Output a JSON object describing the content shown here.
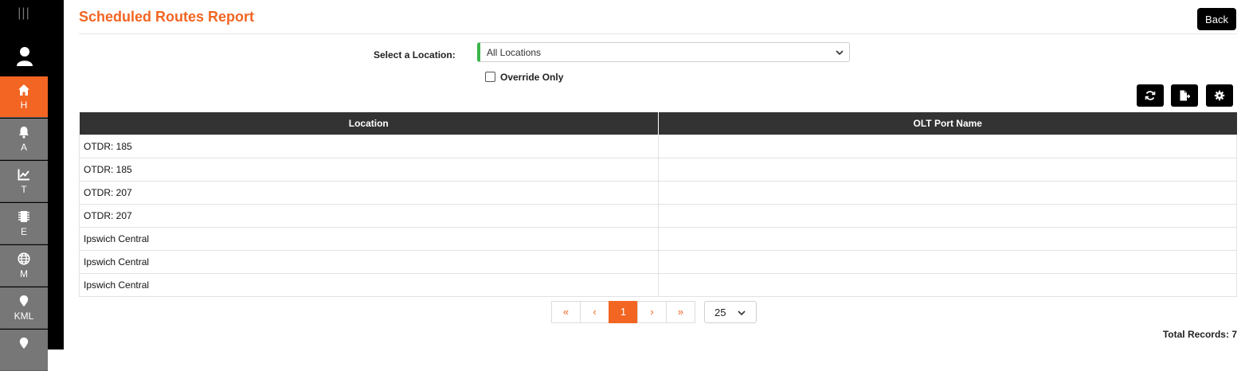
{
  "sidebar": {
    "menu_glyph": "|||",
    "items": [
      {
        "label": "H",
        "icon": "home-icon",
        "active": true
      },
      {
        "label": "A",
        "icon": "bell-icon",
        "active": false
      },
      {
        "label": "T",
        "icon": "trend-chart-icon",
        "active": false
      },
      {
        "label": "E",
        "icon": "chip-icon",
        "active": false
      },
      {
        "label": "M",
        "icon": "globe-icon",
        "active": false
      },
      {
        "label": "KML",
        "icon": "map-pin-icon",
        "active": false
      }
    ]
  },
  "header": {
    "title": "Scheduled Routes Report",
    "back_label": "Back"
  },
  "filters": {
    "location_label": "Select a Location:",
    "location_value": "All Locations",
    "override_label": "Override Only",
    "override_checked": false
  },
  "table": {
    "columns": [
      "Location",
      "OLT Port Name"
    ],
    "rows": [
      [
        "OTDR: 185",
        ""
      ],
      [
        "OTDR: 185",
        ""
      ],
      [
        "OTDR: 207",
        ""
      ],
      [
        "OTDR: 207",
        ""
      ],
      [
        "Ipswich Central",
        ""
      ],
      [
        "Ipswich Central",
        ""
      ],
      [
        "Ipswich Central",
        ""
      ]
    ]
  },
  "pagination": {
    "first": "«",
    "prev": "‹",
    "current": "1",
    "next": "›",
    "last": "»",
    "page_size": "25"
  },
  "footer": {
    "total_label": "Total Records: 7"
  },
  "colors": {
    "accent": "#f26522",
    "nav_inactive": "#777777",
    "header_dark": "#333333",
    "select_indicator": "#3bb54a"
  }
}
